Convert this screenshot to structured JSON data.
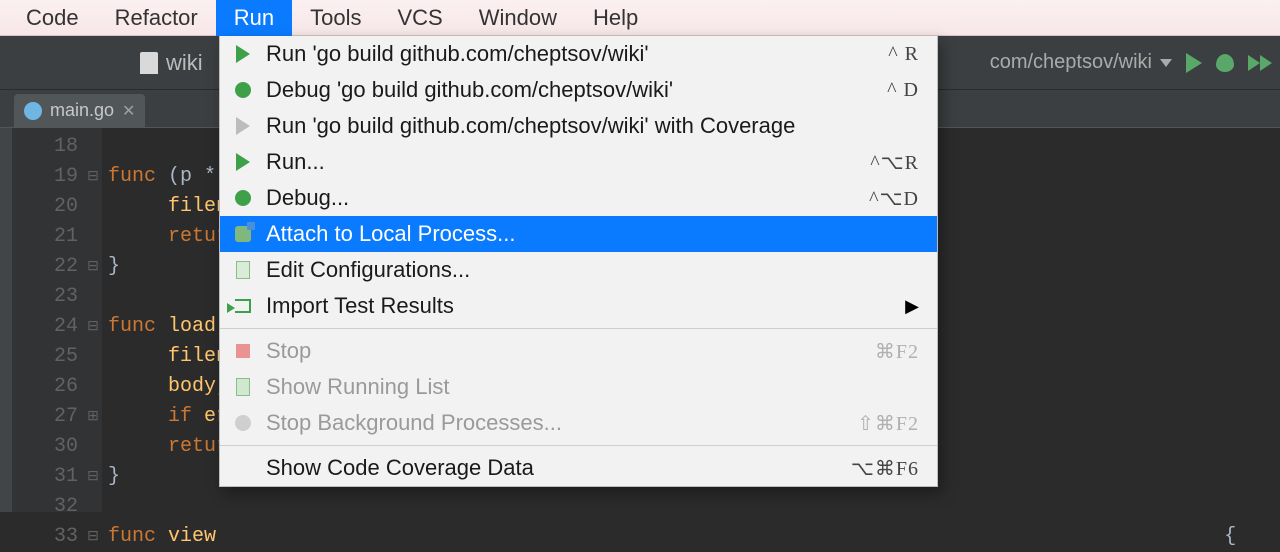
{
  "menubar": {
    "items": [
      "Code",
      "Refactor",
      "Run",
      "Tools",
      "VCS",
      "Window",
      "Help"
    ],
    "activeIndex": 2
  },
  "toolbar": {
    "filename": "wiki",
    "runConfig": "com/cheptsov/wiki"
  },
  "tab": {
    "label": "main.go"
  },
  "editor": {
    "lines": [
      "18",
      "19",
      "20",
      "21",
      "22",
      "23",
      "24",
      "25",
      "26",
      "27",
      "30",
      "31",
      "32",
      "33"
    ]
  },
  "runMenu": {
    "items": [
      {
        "icon": "play",
        "label": "Run 'go build github.com/cheptsov/wiki'",
        "shortcut": "^ R",
        "disabled": false
      },
      {
        "icon": "bug",
        "label": "Debug 'go build github.com/cheptsov/wiki'",
        "shortcut": "^ D",
        "disabled": false
      },
      {
        "icon": "play-grey",
        "label": "Run 'go build github.com/cheptsov/wiki' with Coverage",
        "shortcut": "",
        "disabled": false
      },
      {
        "icon": "play",
        "label": "Run...",
        "shortcut": "^⌥R",
        "disabled": false
      },
      {
        "icon": "bug",
        "label": "Debug...",
        "shortcut": "^⌥D",
        "disabled": false
      },
      {
        "icon": "attach",
        "label": "Attach to Local Process...",
        "shortcut": "",
        "disabled": false,
        "selected": true
      },
      {
        "icon": "edit",
        "label": "Edit Configurations...",
        "shortcut": "",
        "disabled": false
      },
      {
        "icon": "import",
        "label": "Import Test Results",
        "shortcut": "",
        "disabled": false,
        "submenu": true
      },
      {
        "sep": true
      },
      {
        "icon": "stop",
        "label": "Stop",
        "shortcut": "⌘F2",
        "disabled": true
      },
      {
        "icon": "list",
        "label": "Show Running List",
        "shortcut": "",
        "disabled": true
      },
      {
        "icon": "circle",
        "label": "Stop Background Processes...",
        "shortcut": "⇧⌘F2",
        "disabled": true
      },
      {
        "sep": true
      },
      {
        "icon": "",
        "label": "Show Code Coverage Data",
        "shortcut": "⌥⌘F6",
        "disabled": false
      }
    ]
  }
}
